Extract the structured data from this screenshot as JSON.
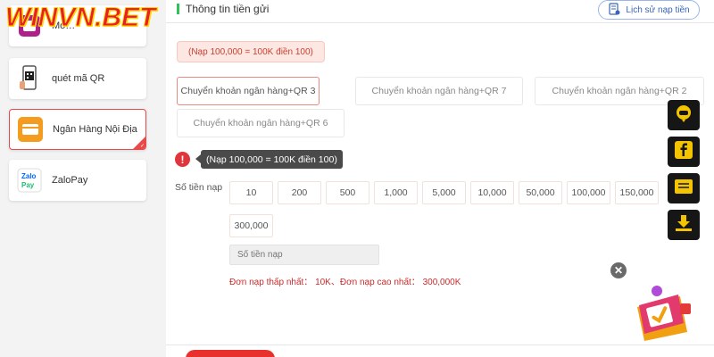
{
  "logo_text": "WINVN.BET",
  "header": {
    "title": "Thông tin tiền gửi",
    "history_label": "Lịch sử nạp tiền"
  },
  "sidebar": {
    "items": [
      {
        "label": "Mo…",
        "icon": "wallet-app-icon"
      },
      {
        "label": "quét mã QR",
        "icon": "qr-phone-icon"
      },
      {
        "label": "Ngân Hàng Nội Địa",
        "icon": "bank-card-icon",
        "active": true
      },
      {
        "label": "ZaloPay",
        "icon": "zalopay-icon"
      }
    ]
  },
  "rate_note": "(Nạp 100,000 = 100K điền 100)",
  "bank_options": [
    "Chuyển khoản ngân hàng+QR 3",
    "Chuyển khoản ngân hàng+QR 7",
    "Chuyển khoản ngân hàng+QR 2",
    "Chuyển khoản ngân hàng+QR 6"
  ],
  "tooltip_text": "(Nạp 100,000 = 100K điền 100)",
  "amount_label": "Số tiền nạp",
  "amounts": [
    "10",
    "200",
    "500",
    "1,000",
    "5,000",
    "10,000",
    "50,000",
    "100,000",
    "150,000",
    "300,000"
  ],
  "amount_placeholder": "Số tiền nạp",
  "limit_text": "Đơn nạp thấp nhất： 10K、Đơn nạp cao nhất： 300,000K",
  "colors": {
    "accent_red": "#e8302c",
    "status_green": "#2fc25b",
    "link_blue": "#3a64b8"
  },
  "float_icons": [
    "chat-support-icon",
    "facebook-icon",
    "message-icon",
    "download-icon"
  ],
  "close_symbol": "✕"
}
